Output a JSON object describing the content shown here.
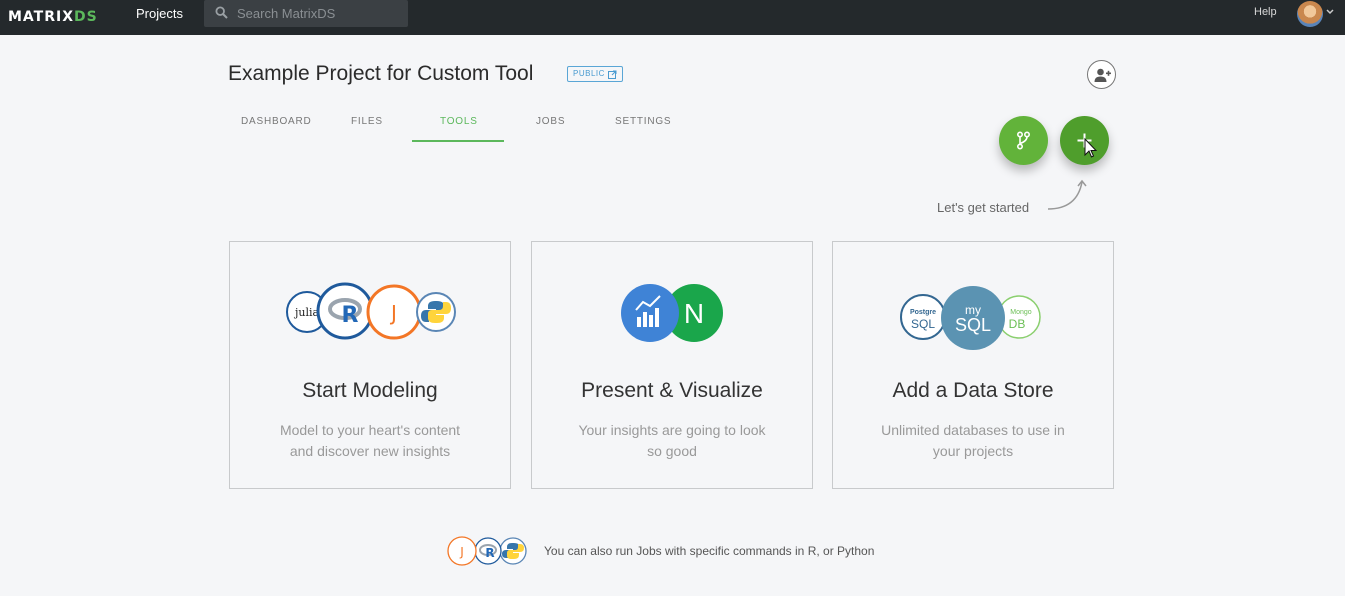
{
  "topbar": {
    "logo_main": "MATRIX",
    "logo_accent": "DS",
    "projects_label": "Projects",
    "search_placeholder": "Search MatrixDS",
    "help_label": "Help"
  },
  "project": {
    "title": "Example Project for Custom Tool",
    "visibility_badge": "PUBLIC"
  },
  "tabs": [
    {
      "label": "DASHBOARD",
      "active": false
    },
    {
      "label": "FILES",
      "active": false
    },
    {
      "label": "TOOLS",
      "active": true
    },
    {
      "label": "JOBS",
      "active": false
    },
    {
      "label": "SETTINGS",
      "active": false
    }
  ],
  "actions": {
    "hint": "Let's get started",
    "branch_icon": "git-branch-icon",
    "add_icon": "plus-icon"
  },
  "cards": [
    {
      "title": "Start Modeling",
      "desc_line1": "Model to your heart's content",
      "desc_line2": "and discover new insights",
      "logos": {
        "julia": "julia",
        "r": "R",
        "jupyter": "J"
      }
    },
    {
      "title": "Present & Visualize",
      "desc_line1": "Your insights are going to look",
      "desc_line2": "so good",
      "logos": {
        "n": "N"
      }
    },
    {
      "title": "Add a Data Store",
      "desc_line1": "Unlimited databases to use in",
      "desc_line2": "your projects",
      "logos": {
        "postgre_top": "Postgre",
        "postgre_bottom": "SQL",
        "mysql_top": "my",
        "mysql_bottom": "SQL",
        "mongo_top": "Mongo",
        "mongo_bottom": "DB"
      }
    }
  ],
  "footer": {
    "text": "You can also run Jobs with specific commands in R, or Python",
    "logos": {
      "jupyter": "J",
      "r": "R"
    }
  },
  "colors": {
    "topbar": "#24292c",
    "accent_green": "#5cb85c",
    "fab_green": "#4f9e2c",
    "badge_blue": "#4a9bd0"
  }
}
